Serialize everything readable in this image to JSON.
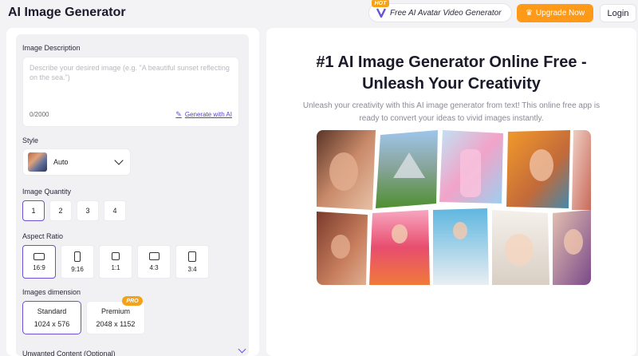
{
  "header": {
    "title": "AI Image Generator",
    "hot_badge": "HOT",
    "avatar_link": "Free AI Avatar Video Generator",
    "upgrade_label": "Upgrade Now",
    "login_label": "Login"
  },
  "form": {
    "description": {
      "label": "Image Description",
      "placeholder": "Describe your desired image (e.g. \"A beautiful sunset reflecting on the sea.\")",
      "char_count": "0/2000",
      "generate_ai_label": "Generate with AI"
    },
    "style": {
      "label": "Style",
      "value": "Auto"
    },
    "quantity": {
      "label": "Image Quantity",
      "options": [
        "1",
        "2",
        "3",
        "4"
      ],
      "selected": "1"
    },
    "aspect_ratio": {
      "label": "Aspect Ratio",
      "options": [
        "16:9",
        "9:16",
        "1:1",
        "4:3",
        "3:4"
      ],
      "selected": "16:9"
    },
    "dimension": {
      "label": "Images dimension",
      "options": [
        {
          "name": "Standard",
          "size": "1024 x 576"
        },
        {
          "name": "Premium",
          "size": "2048 x 1152",
          "badge": "PRO"
        }
      ],
      "selected": "Standard"
    },
    "unwanted": {
      "label": "Unwanted Content (Optional)"
    }
  },
  "hero": {
    "title_line1": "#1 AI Image Generator Online Free -",
    "title_line2": "Unleash Your Creativity",
    "subtitle_line1": "Unleash your creativity with this AI image generator from text! This online free app is",
    "subtitle_line2": "ready to convert your ideas to vivid images instantly."
  },
  "colors": {
    "accent": "#6b4fd6",
    "upgrade": "#ff9a18",
    "badge": "#f4a21a"
  }
}
